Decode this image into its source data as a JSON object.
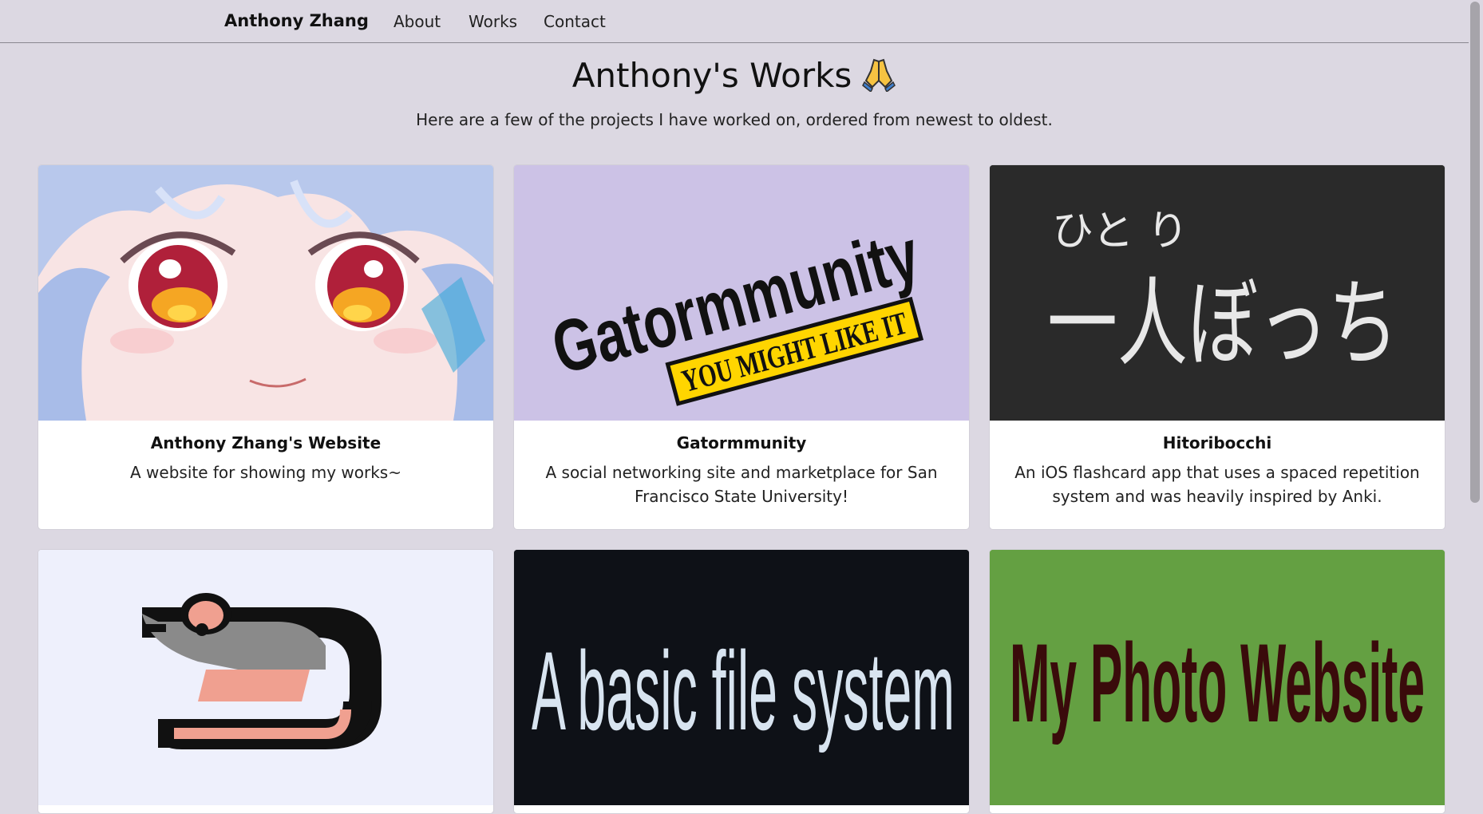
{
  "nav": {
    "brand": "Anthony Zhang",
    "links": [
      "About",
      "Works",
      "Contact"
    ]
  },
  "header": {
    "title": "Anthony's Works",
    "subtitle": "Here are a few of the projects I have worked on, ordered from newest to oldest."
  },
  "cards": [
    {
      "title": "Anthony Zhang's Website",
      "text": "A website for showing my works~",
      "image": "anime-girl-face-illustration"
    },
    {
      "title": "Gatormmunity",
      "text": "A social networking site and marketplace for San Francisco State University!",
      "image_text": [
        "Gatormmunity",
        "YOU MIGHT LIKE IT"
      ]
    },
    {
      "title": "Hitoribocchi",
      "text": "An iOS flashcard app that uses a spaced repetition system and was heavily inspired by Anki.",
      "image_text": [
        "ひと り",
        "一人ぼっち"
      ]
    },
    {
      "image": "rat-icon"
    },
    {
      "image_text": [
        "A basic file system"
      ]
    },
    {
      "image_text": [
        "My Photo Website"
      ]
    }
  ],
  "colors": {
    "background": "#dcd8e2",
    "card": "#ffffff",
    "gator_bg": "#ccc2e6",
    "gator_banner": "#ffd500",
    "hitori_bg": "#2a2a2a",
    "rat_bg": "#eef0fc",
    "fs_bg": "#0e1117",
    "photo_bg": "#64a042",
    "photo_text": "#3a0b0b"
  }
}
